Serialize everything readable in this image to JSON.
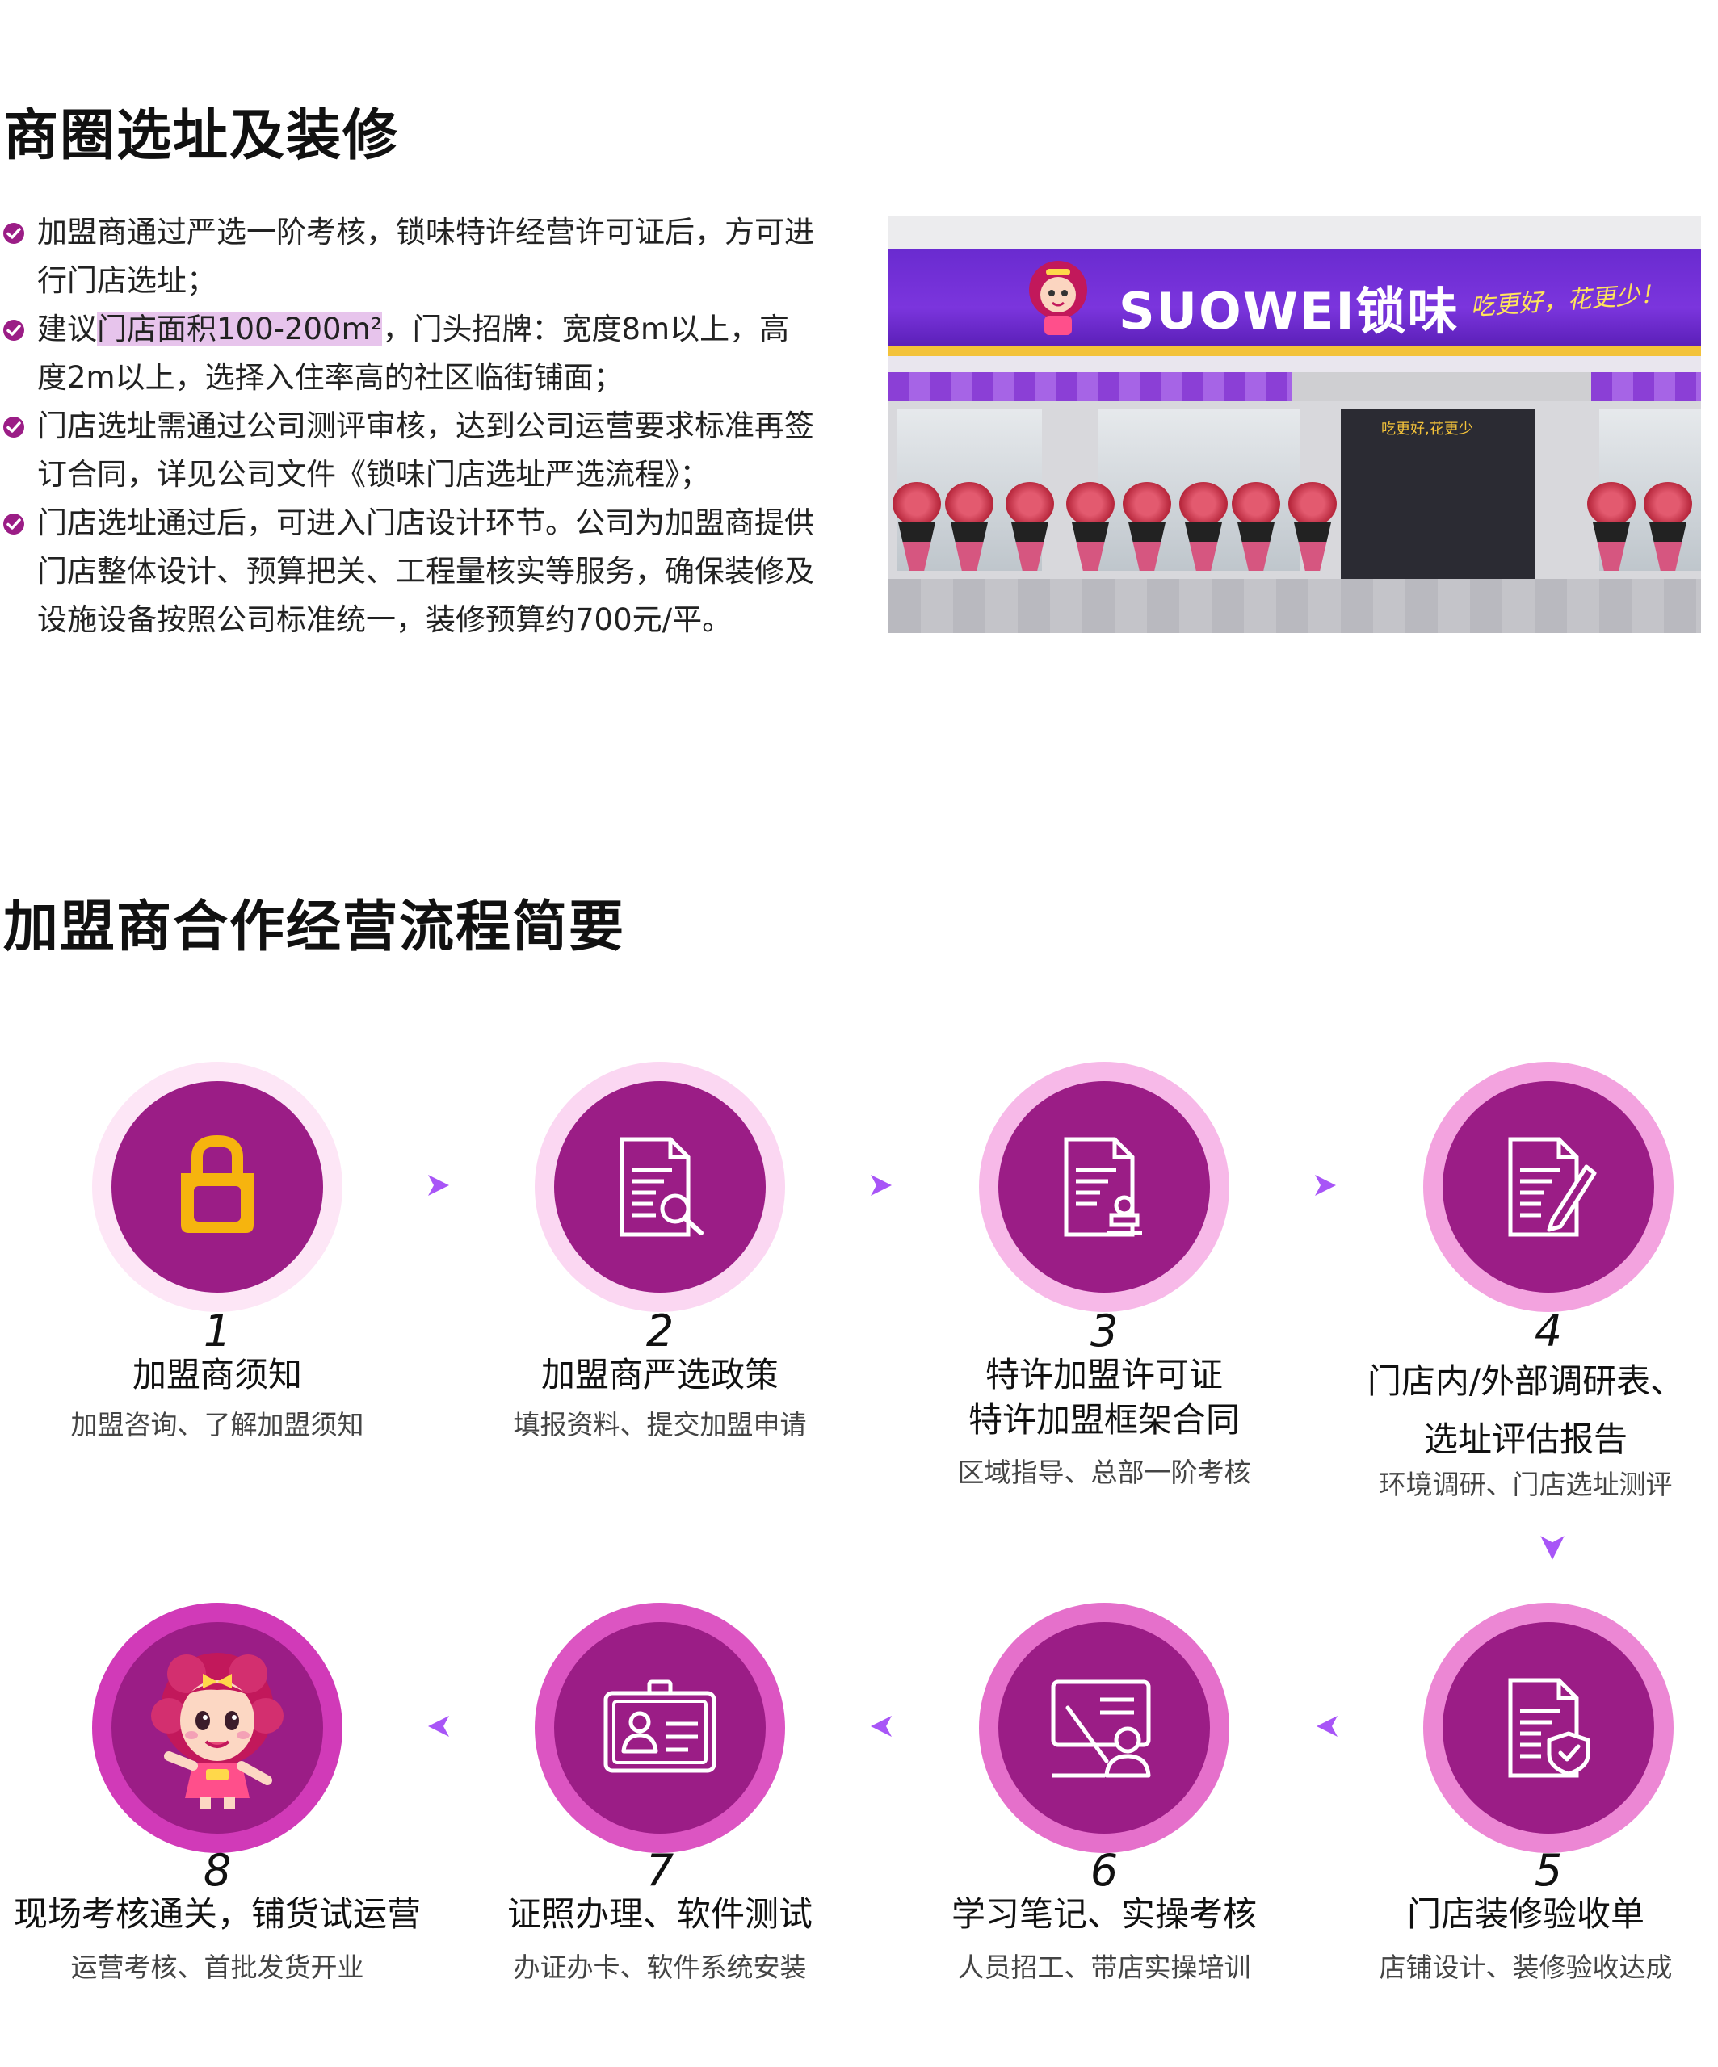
{
  "section1": {
    "title": "商圈选址及装修",
    "bullets": [
      {
        "pre": "加盟商通过严选一阶考核，锁味特许经营许可证后，方可进行门店选址；",
        "hl": "",
        "post": ""
      },
      {
        "pre": "建议",
        "hl": "门店面积100-200m²",
        "post": "，门头招牌：宽度8m以上，高度2m以上，选择入住率高的社区临街铺面；"
      },
      {
        "pre": "门店选址需通过公司测评审核，达到公司运营要求标准再签订合同，详见公司文件《锁味门店选址严选流程》；",
        "hl": "",
        "post": ""
      },
      {
        "pre": "门店选址通过后，可进入门店设计环节。公司为加盟商提供门店整体设计、预算把关、工程量核实等服务，确保装修及设施设备按照公司标准统一，装修预算约700元/平。",
        "hl": "",
        "post": ""
      }
    ],
    "photo": {
      "brand": "SUOWEI锁味",
      "slogan": "吃更好，花更少！",
      "door_sign": "吃更好,花更少"
    }
  },
  "section2": {
    "title": "加盟商合作经营流程简要",
    "steps": [
      {
        "num": "1",
        "label": "加盟商须知",
        "sub": "加盟咨询、了解加盟须知",
        "icon": "shopping-bag-icon"
      },
      {
        "num": "2",
        "label": "加盟商严选政策",
        "sub": "填报资料、提交加盟申请",
        "icon": "document-search-icon"
      },
      {
        "num": "3",
        "label": "特许加盟许可证\n特许加盟框架合同",
        "sub": "区域指导、总部一阶考核",
        "icon": "document-stamp-icon"
      },
      {
        "num": "4",
        "label": "门店内/外部调研表、\n选址评估报告",
        "sub": "环境调研、门店选址测评",
        "icon": "document-pen-icon"
      },
      {
        "num": "5",
        "label": "门店装修验收单",
        "sub": "店铺设计、装修验收达成",
        "icon": "document-shield-icon"
      },
      {
        "num": "6",
        "label": "学习笔记、实操考核",
        "sub": "人员招工、带店实操培训",
        "icon": "teacher-board-icon"
      },
      {
        "num": "7",
        "label": "证照办理、软件测试",
        "sub": "办证办卡、软件系统安装",
        "icon": "id-card-icon"
      },
      {
        "num": "8",
        "label": "现场考核通关，铺货试运营",
        "sub": "运营考核、首批发货开业",
        "icon": "mascot-icon"
      }
    ]
  },
  "colors": {
    "primary": "#9b1d86",
    "accent": "#a855f7",
    "highlight": "#e7c4ec",
    "bag": "#f6b40e"
  }
}
